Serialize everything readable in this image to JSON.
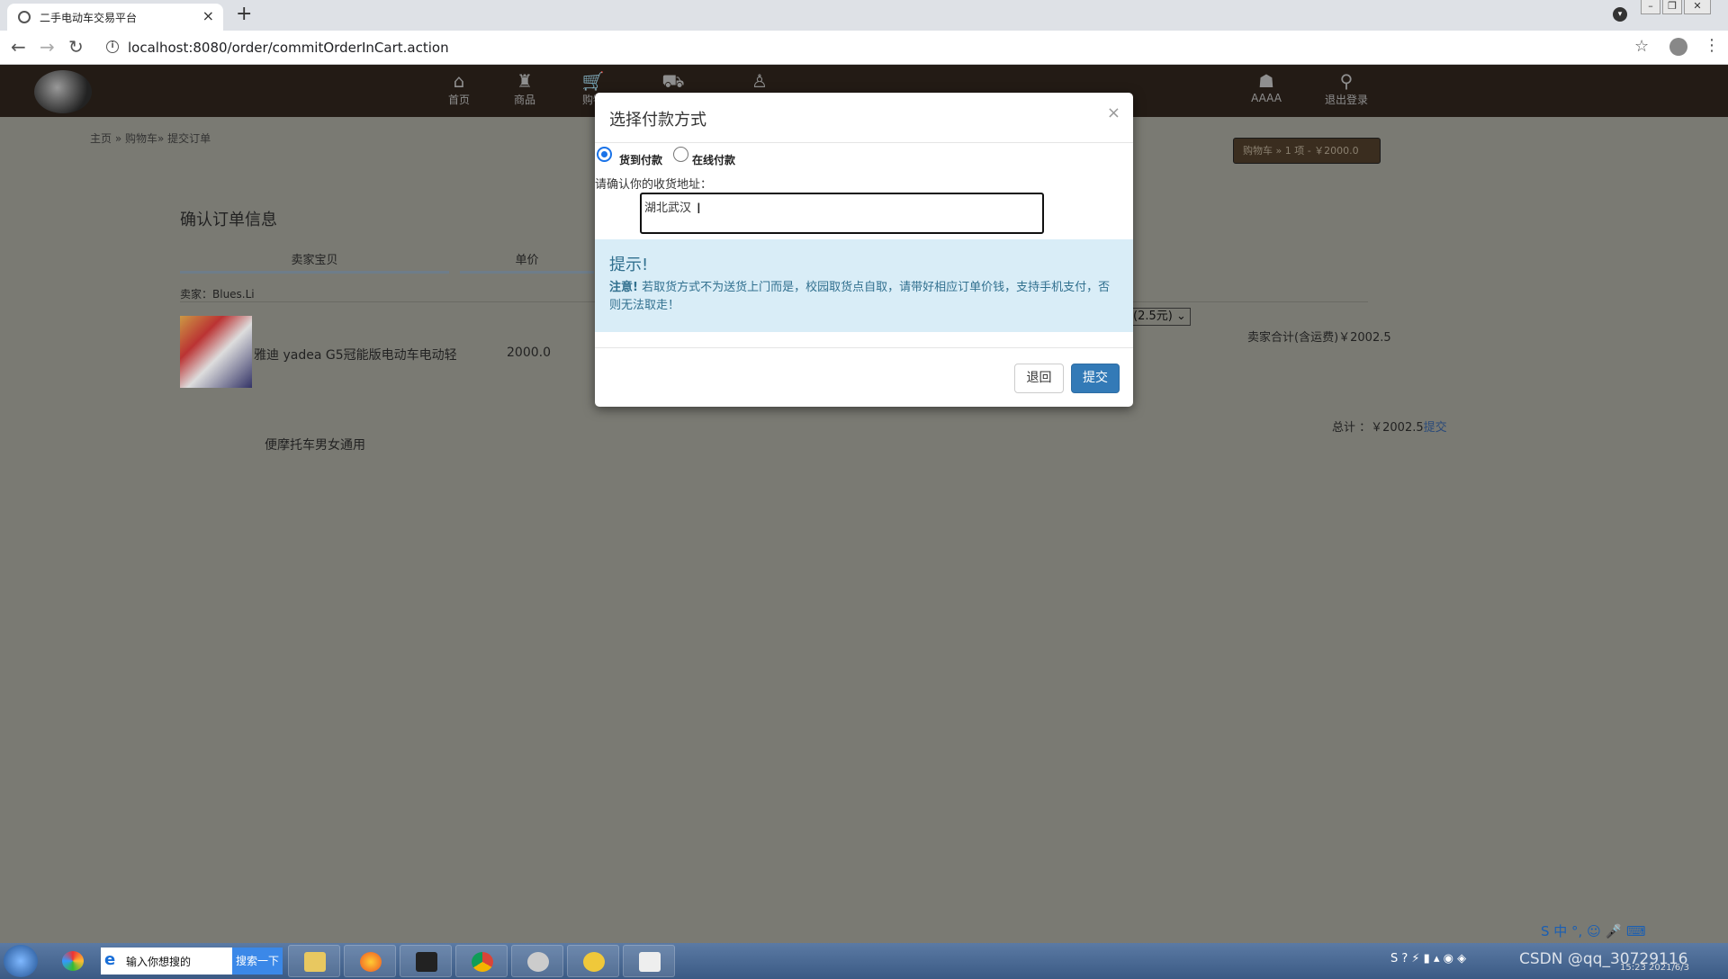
{
  "browser": {
    "tab_title": "二手电动车交易平台",
    "tab_close": "×",
    "new_tab": "+",
    "url": "localhost:8080/order/commitOrderInCart.action",
    "back": "←",
    "forward": "→",
    "reload": "↻",
    "star": "☆",
    "kebab": "⋮"
  },
  "site_nav": {
    "items": [
      {
        "label": "首页",
        "icon": "home-icon"
      },
      {
        "label": "商品",
        "icon": "basket-icon"
      },
      {
        "label": "购物",
        "icon": "cart-icon"
      },
      {
        "label": "",
        "icon": "truck-icon"
      },
      {
        "label": "",
        "icon": "user-add-icon"
      }
    ],
    "user_label": "AAAA",
    "logout_label": "退出登录"
  },
  "page": {
    "breadcrumb": "主页 » 购物车» 提交订单",
    "cart_pill": "购物车  » 1 项 - ￥2000.0",
    "order_title": "确认订单信息",
    "col_seller_item": "卖家宝贝",
    "col_price": "单价",
    "seller_line": "卖家：Blues.Li",
    "product_name": "雅迪 yadea G5冠能版电动车电动轻",
    "product_name_line2": "便摩托车男女通用",
    "product_price": "2000.0",
    "shipping_select": "(2.5元)",
    "seller_total": "卖家合计(含运费)￥2002.5",
    "grand_total": "总计 ：￥2002.5",
    "grand_total_link": "提交"
  },
  "modal": {
    "title": "选择付款方式",
    "close": "×",
    "option_cod": "货到付款",
    "option_online": "在线付款",
    "selected": "货到付款",
    "address_label": "请确认你的收货地址：",
    "address_value": "湖北武汉",
    "alert_title": "提示!",
    "alert_strong": "注意!",
    "alert_text": "若取货方式不为送货上门而是，校园取货点自取，请带好相应订单价钱，支持手机支付，否则无法取走！",
    "back_button": "退回",
    "submit_button": "提交"
  },
  "taskbar": {
    "search_placeholder": "输入你想搜的",
    "search_button": "搜索一下",
    "tray_text": "CSDN @qq_30729116",
    "clock_time": "15:23",
    "clock_date": "2021/6/3",
    "ime": "S 中 °, ☺ 🎤 ⌨"
  },
  "colors": {
    "header_bg": "#231b15",
    "overlay_page": "#7a7a73",
    "primary_button": "#337ab7",
    "alert_bg": "#d9edf7",
    "alert_text": "#31708f"
  }
}
